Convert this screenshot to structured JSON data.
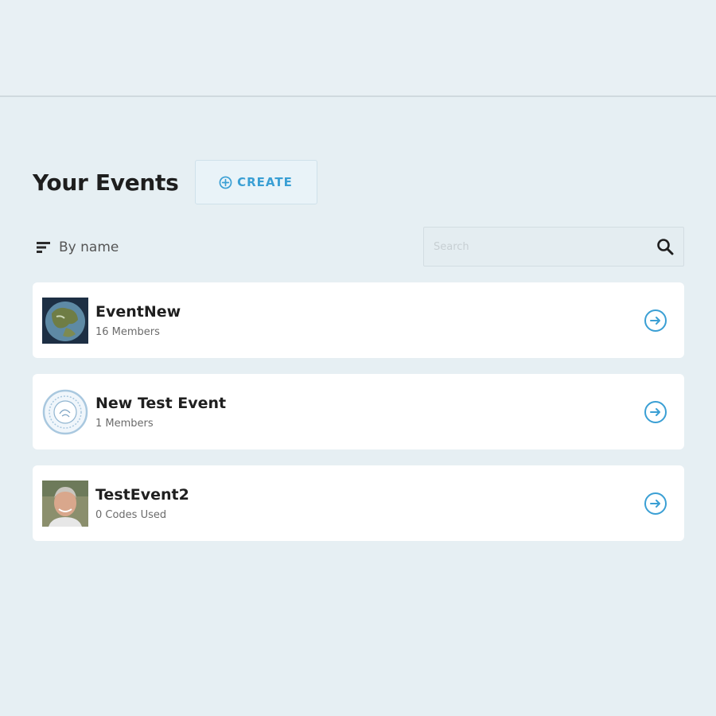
{
  "header": {
    "title": "Your Events",
    "create_label": "CREATE"
  },
  "toolbar": {
    "sort_label": "By name",
    "search_placeholder": "Search",
    "search_value": ""
  },
  "events": [
    {
      "name": "EventNew",
      "meta": "16 Members",
      "thumb": "globe-image"
    },
    {
      "name": "New Test Event",
      "meta": "1 Members",
      "thumb": "seal-logo"
    },
    {
      "name": "TestEvent2",
      "meta": "0 Codes Used",
      "thumb": "person-photo"
    }
  ],
  "colors": {
    "accent": "#3a9fd4",
    "background": "#e6eff3",
    "card": "#ffffff"
  }
}
